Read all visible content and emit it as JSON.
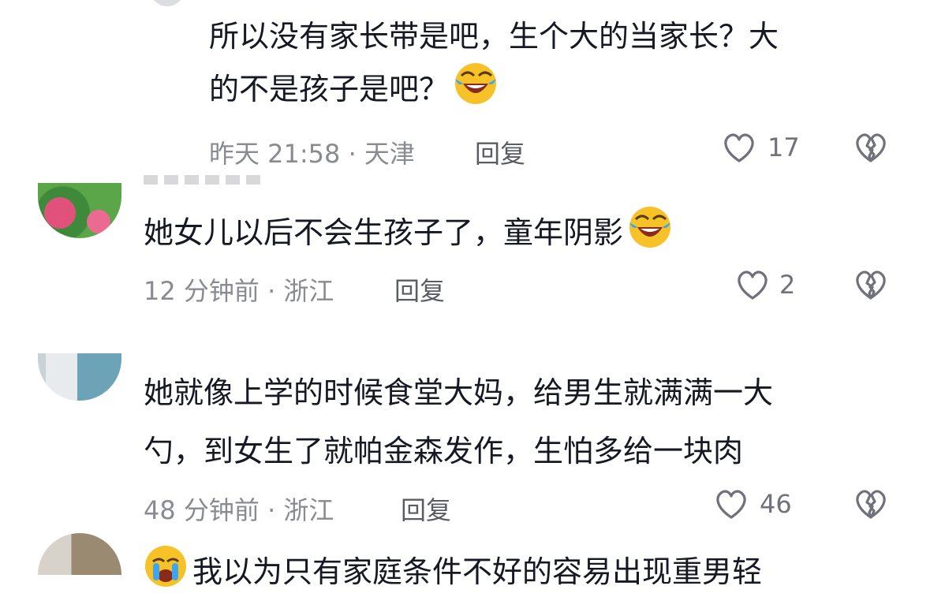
{
  "comments": [
    {
      "lines": [
        "所以没有家长带是吧，生个大的当家长？大",
        "的不是孩子是吧？"
      ],
      "emoji": "laughing-tears",
      "time_location": "昨天 21:58 · 天津",
      "reply_label": "回复",
      "likes": "17"
    },
    {
      "lines": [
        "她女儿以后不会生孩子了，童年阴影"
      ],
      "emoji": "laughing-tears",
      "time_location": "12 分钟前 · 浙江",
      "reply_label": "回复",
      "likes": "2"
    },
    {
      "lines": [
        "她就像上学的时候食堂大妈，给男生就满满一大",
        "勺，到女生了就帕金森发作，生怕多给一块肉"
      ],
      "time_location": "48 分钟前 · 浙江",
      "reply_label": "回复",
      "likes": "46"
    },
    {
      "lines": [
        "我以为只有家庭条件不好的容易出现重男轻"
      ],
      "emoji_prefix": "crying"
    }
  ],
  "icons": {
    "like": "heart-outline-icon",
    "dislike": "broken-heart-icon"
  },
  "colors": {
    "text": "#161823",
    "meta": "#8a8b91",
    "emoji_face": "#f6c227"
  }
}
